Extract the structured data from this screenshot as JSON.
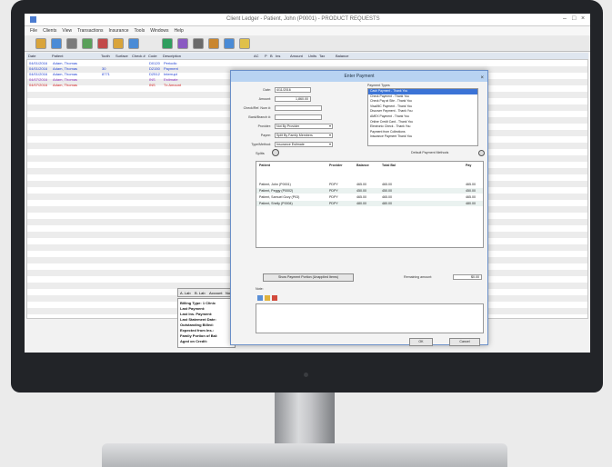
{
  "window": {
    "title": "Client Ledger - Patient, John (P0001) - PRODUCT REQUESTS",
    "controls": [
      "–",
      "□",
      "×"
    ]
  },
  "menu": [
    "File",
    "Clients",
    "View",
    "Transactions",
    "Insurance",
    "Tools",
    "Windows",
    "Help"
  ],
  "toolbar_icons": [
    "open-icon",
    "save-icon",
    "print-icon",
    "search-icon",
    "edit-icon",
    "delete-icon",
    "refresh-icon",
    "money-icon",
    "chart-icon",
    "settings-icon",
    "user-icon",
    "group-icon",
    "help-icon"
  ],
  "ledger": {
    "columns": [
      "Date",
      "Patient",
      "Tooth",
      "Surface",
      "Check #",
      "Code",
      "Description",
      "AC",
      "P",
      "B",
      "Ins",
      "Amount",
      "Units",
      "Tax",
      "Balance"
    ],
    "rows": [
      {
        "date": "04/01/2016",
        "patient": "Adam, Thomas",
        "tooth": "",
        "code": "D0120",
        "description": "Periodic",
        "color": "#1e3fd2"
      },
      {
        "date": "04/01/2016",
        "patient": "Adam, Thomas",
        "tooth": "30",
        "code": "D2150",
        "description": "Payment",
        "color": "#1e3fd2"
      },
      {
        "date": "04/01/2016",
        "patient": "Adam, Thomas",
        "tooth": "8771",
        "code": "D2512",
        "description": "Interrupt",
        "color": "#1e3fd2"
      },
      {
        "date": "04/07/2016",
        "patient": "Adam, Thomas",
        "tooth": "",
        "code": "INS",
        "description": "Estimate",
        "color": "#8a2fbf"
      },
      {
        "date": "04/07/2016",
        "patient": "Adam, Thomas",
        "tooth": "",
        "code": "INS",
        "description": "Tx Amount",
        "color": "#d22222"
      }
    ]
  },
  "detail": {
    "tabs": [
      "A. Lab",
      "B. Lab",
      "Account",
      "Note"
    ],
    "lines": [
      "Billing Type: 1 Clinic",
      "Last Payment:",
      "Last Ins. Payment:",
      "Last Statement Date:",
      "Outstanding Billed:",
      "Expected from Ins.:",
      "Family Portion of Bal:",
      "Aged on Credit:"
    ]
  },
  "dialog": {
    "title": "Enter Payment",
    "close": "×",
    "fields": {
      "date_label": "Date:",
      "date_value": "4/11/2016",
      "amount_label": "Amount:",
      "amount_value": "1,860.00",
      "check_label": "Check/Ref. Num #:",
      "check_value": "",
      "bank_label": "Bank/Branch #:",
      "bank_value": "",
      "provider_label": "Provider:",
      "provider_value": "Not By Provider",
      "payee_label": "Payee:",
      "payee_value": "Split By Family Members",
      "type_label": "Type/Method:",
      "type_value": "Insurance Estimate"
    },
    "memo_header": "Payment Types",
    "memo_items": [
      "Cash Payment - Thank You",
      "Check Payment - Thank You",
      "Check Pay at Site - Thank You",
      "Visa/MC Payment - Thank You",
      "Discover Payment - Thank You",
      "AMEX Payment - Thank You",
      "Online Credit Card - Thank You",
      "Electronic Check - Thank You",
      "Payment from Collections",
      "Insurance Payment Thank You"
    ],
    "selected_memo": 0,
    "split_label": "Splits",
    "default_label": "Default Payment Methods",
    "grid": {
      "headers": [
        "Patient",
        "Provider",
        "Balance",
        "Total Bal",
        "Pay"
      ],
      "rows": [
        {
          "patient": "Patient, John (P0001)",
          "provider": "PDPY",
          "balance": "465.00",
          "total": "465.00",
          "pay": "465.00"
        },
        {
          "patient": "Patient, Peggy (P0002)",
          "provider": "PDPY",
          "balance": "450.00",
          "total": "450.00",
          "pay": "450.00"
        },
        {
          "patient": "Patient, Samuel Ozzy (P03)",
          "provider": "PDPY",
          "balance": "465.00",
          "total": "465.00",
          "pay": "465.00"
        },
        {
          "patient": "Patient, Shelly (P0004)",
          "provider": "PDPY",
          "balance": "480.00",
          "total": "480.00",
          "pay": "480.00"
        }
      ]
    },
    "post_button": "Show Payment Portion (Unapplied Items)",
    "remaining_label": "Remaining amount:",
    "remaining_value": "$0.00",
    "note_label": "Note:",
    "ok": "OK",
    "cancel": "Cancel"
  }
}
